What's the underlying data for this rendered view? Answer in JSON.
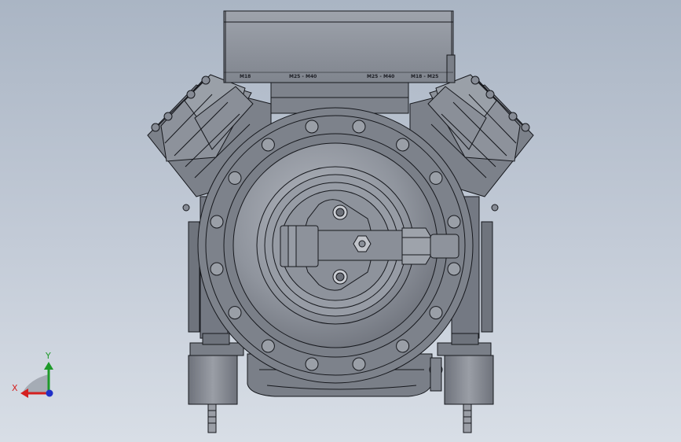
{
  "terminal_box": {
    "labels": [
      "M18",
      "M25 - M40",
      "M25 - M40",
      "M18 - M25"
    ]
  },
  "triad": {
    "x_label": "X",
    "y_label": "Y",
    "colors": {
      "x": "#d42020",
      "y": "#1e9a2a",
      "z": "#2030c8"
    }
  },
  "colors": {
    "background_top": "#aab5c4",
    "background_bottom": "#d8dee6",
    "metal": "#868b95",
    "metal_dark": "#5f636c",
    "edge": "#16181d"
  }
}
